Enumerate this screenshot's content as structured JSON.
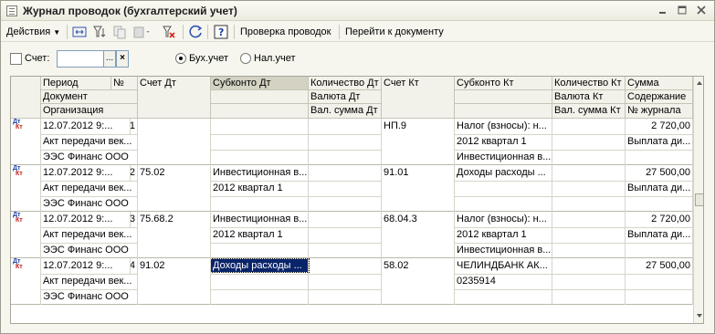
{
  "window": {
    "title": "Журнал проводок (бухгалтерский учет)"
  },
  "toolbar": {
    "actions_label": "Действия",
    "check_label": "Проверка проводок",
    "goto_label": "Перейти к документу"
  },
  "filter": {
    "account_label": "Счет:",
    "account_value": "",
    "ellipsis": "...",
    "clear": "×",
    "buh_label": "Бух.учет",
    "nal_label": "Нал.учет",
    "selected": "Бух.учет"
  },
  "columns": {
    "period": "Период",
    "no": "№",
    "document": "Документ",
    "organization": "Организация",
    "acc_dt": "Счет Дт",
    "subconto_dt": "Субконто Дт",
    "qty_dt": "Количество Дт",
    "cur_dt": "Валюта Дт",
    "cur_sum_dt": "Вал. сумма Дт",
    "acc_kt": "Счет Кт",
    "subconto_kt": "Субконто Кт",
    "qty_kt": "Количество Кт",
    "cur_kt": "Валюта Кт",
    "cur_sum_kt": "Вал. сумма Кт",
    "sum": "Сумма",
    "content": "Содержание",
    "journal_no": "№ журнала"
  },
  "rows": [
    {
      "period": "12.07.2012 9:...",
      "no": "1",
      "document": "Акт передачи век...",
      "organization": "ЭЭС Финанс ООО",
      "acc_dt": "",
      "subconto_dt": [
        "",
        "",
        ""
      ],
      "acc_kt": "НП.9",
      "subconto_kt": [
        "Налог (взносы): н...",
        "2012 квартал 1",
        "Инвестиционная в..."
      ],
      "sum": "2 720,00",
      "content": "Выплата ди..."
    },
    {
      "period": "12.07.2012 9:...",
      "no": "2",
      "document": "Акт передачи век...",
      "organization": "ЭЭС Финанс ООО",
      "acc_dt": "75.02",
      "subconto_dt": [
        "Инвестиционная в...",
        "2012 квартал 1",
        ""
      ],
      "acc_kt": "91.01",
      "subconto_kt": [
        "Доходы расходы ...",
        "",
        ""
      ],
      "sum": "27 500,00",
      "content": "Выплата ди..."
    },
    {
      "period": "12.07.2012 9:...",
      "no": "3",
      "document": "Акт передачи век...",
      "organization": "ЭЭС Финанс ООО",
      "acc_dt": "75.68.2",
      "subconto_dt": [
        "Инвестиционная в...",
        "2012 квартал 1",
        ""
      ],
      "acc_kt": "68.04.3",
      "subconto_kt": [
        "Налог (взносы): н...",
        "2012 квартал 1",
        "Инвестиционная в..."
      ],
      "sum": "2 720,00",
      "content": "Выплата ди..."
    },
    {
      "period": "12.07.2012 9:...",
      "no": "4",
      "document": "Акт передачи век...",
      "organization": "ЭЭС Финанс ООО",
      "acc_dt": "91.02",
      "subconto_dt": [
        "Доходы расходы ...",
        "",
        ""
      ],
      "acc_kt": "58.02",
      "subconto_kt": [
        "ЧЕЛИНДБАНК АК...",
        "0235914",
        ""
      ],
      "sum": "27 500,00",
      "content": ""
    }
  ],
  "row_icon": {
    "top": "Дт",
    "bottom": "Кт"
  }
}
